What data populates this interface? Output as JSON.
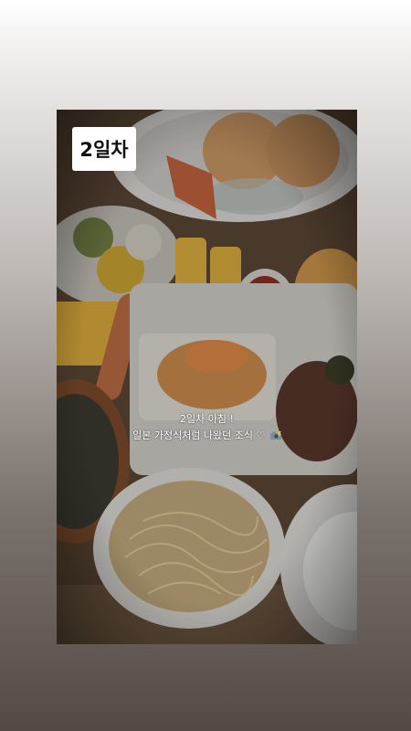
{
  "story": {
    "sticker_text": "2일차",
    "caption_line1": "2일차 아침 !",
    "caption_line2": "일본 가정식처럼 나왔던 조식 ♡",
    "caption_emoji": "camera-with-flash-icon"
  },
  "colors": {
    "sticker_bg": "#ffffff",
    "caption_text": "#ffffff"
  }
}
